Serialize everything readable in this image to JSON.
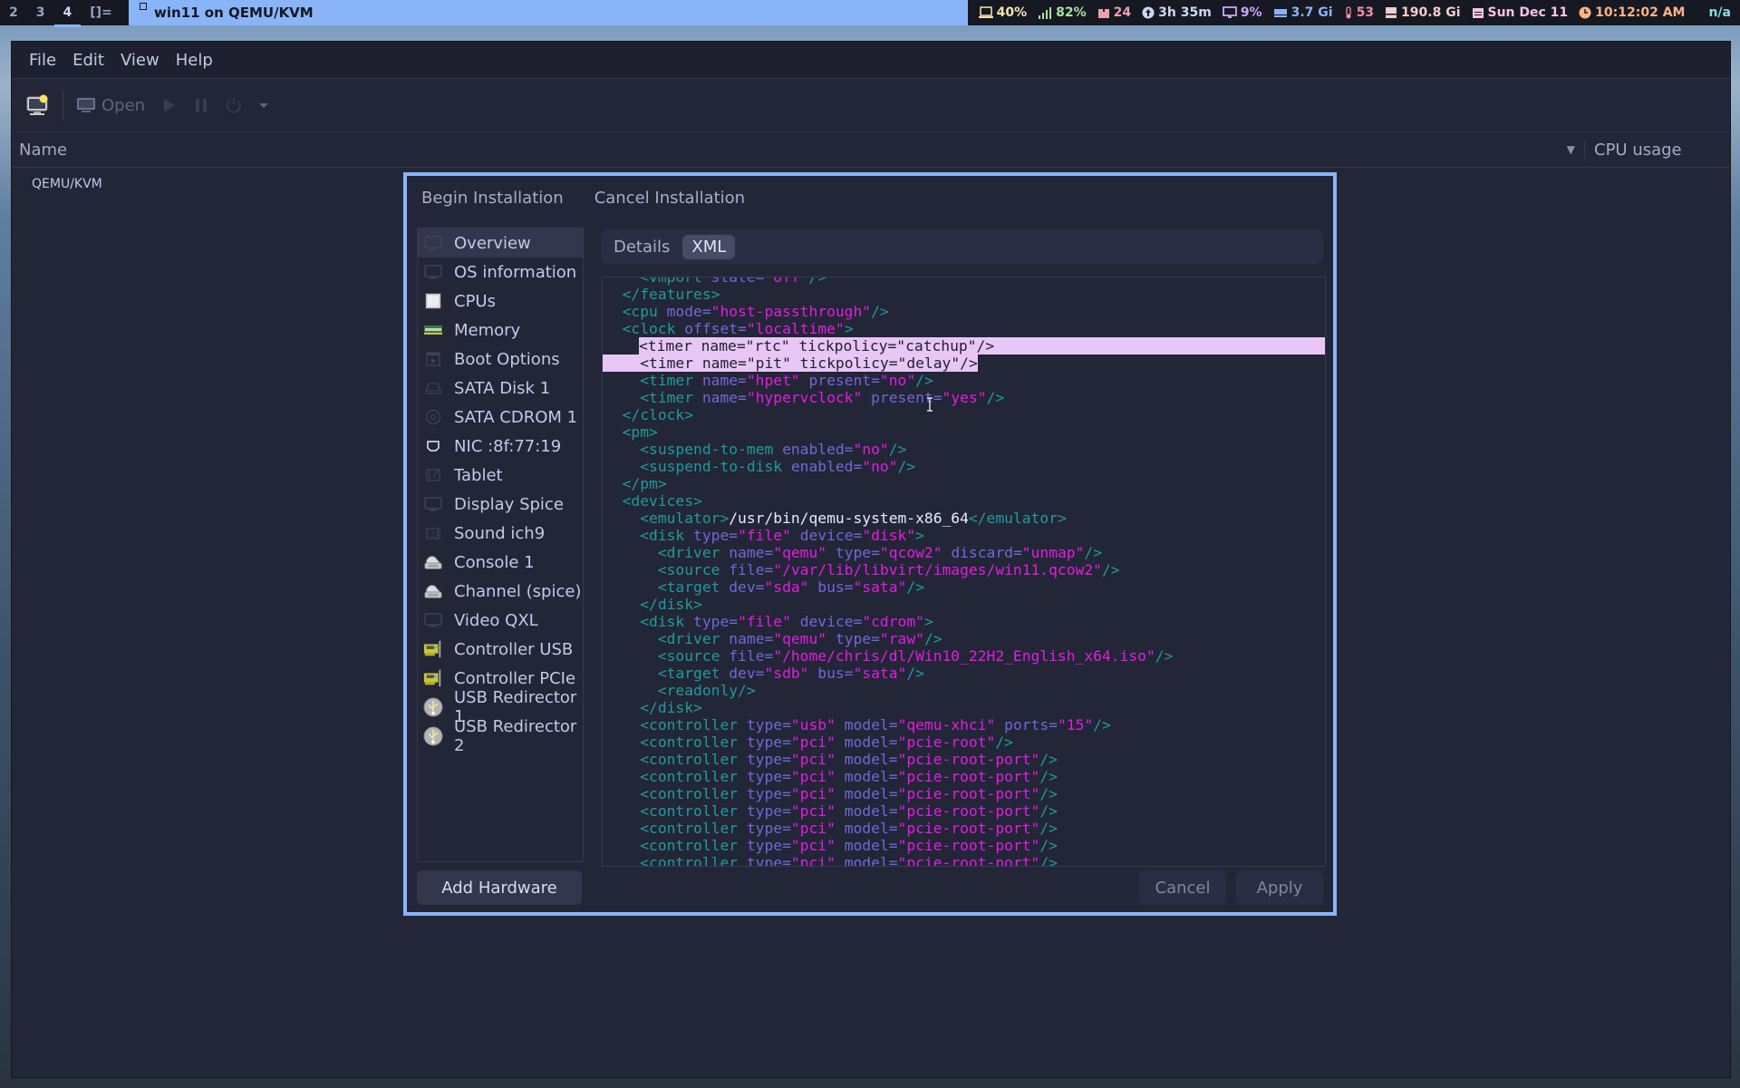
{
  "topbar": {
    "workspaces": [
      {
        "label": "2",
        "active": false
      },
      {
        "label": "3",
        "active": false
      },
      {
        "label": "4",
        "active": true
      },
      {
        "label": "[]=",
        "active": false
      }
    ],
    "window_title": "win11 on QEMU/KVM",
    "status": [
      {
        "icon": "laptop-icon",
        "text": "40%",
        "color": "#f9e2af"
      },
      {
        "icon": "signal-icon",
        "text": "82%",
        "color": "#a6e3a1"
      },
      {
        "icon": "package-icon",
        "text": "24",
        "color": "#eba0ac"
      },
      {
        "icon": "uptime-icon",
        "text": "3h 35m",
        "color": "#cdd6f4"
      },
      {
        "icon": "monitor-icon",
        "text": "9%",
        "color": "#cba6f7"
      },
      {
        "icon": "ram-icon",
        "text": "3.7 Gi",
        "color": "#89b4fa"
      },
      {
        "icon": "thermometer-icon",
        "text": "53",
        "color": "#f38ba8"
      },
      {
        "icon": "disk-icon",
        "text": "190.8 Gi",
        "color": "#f2cdcd"
      },
      {
        "icon": "calendar-icon",
        "text": "Sun Dec 11",
        "color": "#f5c2e7"
      },
      {
        "icon": "clock-icon",
        "text": "10:12:02 AM",
        "color": "#fab387"
      },
      {
        "icon": "none",
        "text": "n/a",
        "color": "#89dceb"
      }
    ]
  },
  "menubar": {
    "items": [
      "File",
      "Edit",
      "View",
      "Help"
    ]
  },
  "toolbar": {
    "open_label": "Open"
  },
  "list": {
    "col_name": "Name",
    "col_cpu": "CPU usage",
    "connection": "QEMU/KVM"
  },
  "dialog": {
    "begin_label": "Begin Installation",
    "cancel_install_label": "Cancel Installation",
    "sidebar": [
      {
        "label": "Overview",
        "icon": "monitor-icon",
        "selected": true
      },
      {
        "label": "OS information",
        "icon": "monitor-icon",
        "selected": false
      },
      {
        "label": "CPUs",
        "icon": "cpu-icon",
        "selected": false
      },
      {
        "label": "Memory",
        "icon": "memory-icon",
        "selected": false
      },
      {
        "label": "Boot Options",
        "icon": "boot-icon",
        "selected": false
      },
      {
        "label": "SATA Disk 1",
        "icon": "harddisk-icon",
        "selected": false
      },
      {
        "label": "SATA CDROM 1",
        "icon": "cdrom-icon",
        "selected": false
      },
      {
        "label": "NIC :8f:77:19",
        "icon": "network-icon",
        "selected": false
      },
      {
        "label": "Tablet",
        "icon": "tablet-icon",
        "selected": false
      },
      {
        "label": "Display Spice",
        "icon": "monitor-icon",
        "selected": false
      },
      {
        "label": "Sound ich9",
        "icon": "soundcard-icon",
        "selected": false
      },
      {
        "label": "Console 1",
        "icon": "serial-icon",
        "selected": false
      },
      {
        "label": "Channel (spice)",
        "icon": "serial-icon",
        "selected": false
      },
      {
        "label": "Video QXL",
        "icon": "monitor-icon",
        "selected": false
      },
      {
        "label": "Controller USB",
        "icon": "pci-card-icon",
        "selected": false
      },
      {
        "label": "Controller PCIe",
        "icon": "pci-card-icon",
        "selected": false
      },
      {
        "label": "USB Redirector 1",
        "icon": "usb-icon",
        "selected": false
      },
      {
        "label": "USB Redirector 2",
        "icon": "usb-icon",
        "selected": false
      }
    ],
    "tabs": [
      {
        "label": "Details",
        "active": false
      },
      {
        "label": "XML",
        "active": true
      }
    ],
    "xml_lines": [
      {
        "indent": 4,
        "hl": false,
        "parts": [
          [
            "t",
            "<vmport "
          ],
          [
            "a",
            "state="
          ],
          [
            "v",
            "\"off\""
          ],
          [
            "t",
            "/>"
          ]
        ]
      },
      {
        "indent": 2,
        "hl": false,
        "parts": [
          [
            "t",
            "</features>"
          ]
        ]
      },
      {
        "indent": 2,
        "hl": false,
        "parts": [
          [
            "t",
            "<cpu "
          ],
          [
            "a",
            "mode="
          ],
          [
            "v",
            "\"host-passthrough\""
          ],
          [
            "t",
            "/>"
          ]
        ]
      },
      {
        "indent": 2,
        "hl": false,
        "parts": [
          [
            "t",
            "<clock "
          ],
          [
            "a",
            "offset="
          ],
          [
            "v",
            "\"localtime\""
          ],
          [
            "t",
            ">"
          ]
        ]
      },
      {
        "indent": 4,
        "hl": true,
        "parts": [
          [
            "t",
            "<timer "
          ],
          [
            "a",
            "name="
          ],
          [
            "v",
            "\"rtc\""
          ],
          [
            "a",
            " tickpolicy="
          ],
          [
            "v",
            "\"catchup\""
          ],
          [
            "t",
            "/>"
          ]
        ]
      },
      {
        "indent": 4,
        "hl": true,
        "parts": [
          [
            "t",
            "<timer "
          ],
          [
            "a",
            "name="
          ],
          [
            "v",
            "\"pit\""
          ],
          [
            "a",
            " tickpolicy="
          ],
          [
            "v",
            "\"delay\""
          ],
          [
            "t",
            "/>"
          ]
        ]
      },
      {
        "indent": 4,
        "hl": false,
        "parts": [
          [
            "t",
            "<timer "
          ],
          [
            "a",
            "name="
          ],
          [
            "v",
            "\"hpet\""
          ],
          [
            "a",
            " present="
          ],
          [
            "v",
            "\"no\""
          ],
          [
            "t",
            "/>"
          ]
        ]
      },
      {
        "indent": 4,
        "hl": false,
        "parts": [
          [
            "t",
            "<timer "
          ],
          [
            "a",
            "name="
          ],
          [
            "v",
            "\"hypervclock\""
          ],
          [
            "a",
            " present="
          ],
          [
            "v",
            "\"yes\""
          ],
          [
            "t",
            "/>"
          ]
        ]
      },
      {
        "indent": 2,
        "hl": false,
        "parts": [
          [
            "t",
            "</clock>"
          ]
        ]
      },
      {
        "indent": 2,
        "hl": false,
        "parts": [
          [
            "t",
            "<pm>"
          ]
        ]
      },
      {
        "indent": 4,
        "hl": false,
        "parts": [
          [
            "t",
            "<suspend-to-mem "
          ],
          [
            "a",
            "enabled="
          ],
          [
            "v",
            "\"no\""
          ],
          [
            "t",
            "/>"
          ]
        ]
      },
      {
        "indent": 4,
        "hl": false,
        "parts": [
          [
            "t",
            "<suspend-to-disk "
          ],
          [
            "a",
            "enabled="
          ],
          [
            "v",
            "\"no\""
          ],
          [
            "t",
            "/>"
          ]
        ]
      },
      {
        "indent": 2,
        "hl": false,
        "parts": [
          [
            "t",
            "</pm>"
          ]
        ]
      },
      {
        "indent": 2,
        "hl": false,
        "parts": [
          [
            "t",
            "<devices>"
          ]
        ]
      },
      {
        "indent": 4,
        "hl": false,
        "parts": [
          [
            "t",
            "<emulator>"
          ],
          [
            "x",
            "/usr/bin/qemu-system-x86_64"
          ],
          [
            "t",
            "</emulator>"
          ]
        ]
      },
      {
        "indent": 4,
        "hl": false,
        "parts": [
          [
            "t",
            "<disk "
          ],
          [
            "a",
            "type="
          ],
          [
            "v",
            "\"file\""
          ],
          [
            "a",
            " device="
          ],
          [
            "v",
            "\"disk\""
          ],
          [
            "t",
            ">"
          ]
        ]
      },
      {
        "indent": 6,
        "hl": false,
        "parts": [
          [
            "t",
            "<driver "
          ],
          [
            "a",
            "name="
          ],
          [
            "v",
            "\"qemu\""
          ],
          [
            "a",
            " type="
          ],
          [
            "v",
            "\"qcow2\""
          ],
          [
            "a",
            " discard="
          ],
          [
            "v",
            "\"unmap\""
          ],
          [
            "t",
            "/>"
          ]
        ]
      },
      {
        "indent": 6,
        "hl": false,
        "parts": [
          [
            "t",
            "<source "
          ],
          [
            "a",
            "file="
          ],
          [
            "v",
            "\"/var/lib/libvirt/images/win11.qcow2\""
          ],
          [
            "t",
            "/>"
          ]
        ]
      },
      {
        "indent": 6,
        "hl": false,
        "parts": [
          [
            "t",
            "<target "
          ],
          [
            "a",
            "dev="
          ],
          [
            "v",
            "\"sda\""
          ],
          [
            "a",
            " bus="
          ],
          [
            "v",
            "\"sata\""
          ],
          [
            "t",
            "/>"
          ]
        ]
      },
      {
        "indent": 4,
        "hl": false,
        "parts": [
          [
            "t",
            "</disk>"
          ]
        ]
      },
      {
        "indent": 4,
        "hl": false,
        "parts": [
          [
            "t",
            "<disk "
          ],
          [
            "a",
            "type="
          ],
          [
            "v",
            "\"file\""
          ],
          [
            "a",
            " device="
          ],
          [
            "v",
            "\"cdrom\""
          ],
          [
            "t",
            ">"
          ]
        ]
      },
      {
        "indent": 6,
        "hl": false,
        "parts": [
          [
            "t",
            "<driver "
          ],
          [
            "a",
            "name="
          ],
          [
            "v",
            "\"qemu\""
          ],
          [
            "a",
            " type="
          ],
          [
            "v",
            "\"raw\""
          ],
          [
            "t",
            "/>"
          ]
        ]
      },
      {
        "indent": 6,
        "hl": false,
        "parts": [
          [
            "t",
            "<source "
          ],
          [
            "a",
            "file="
          ],
          [
            "v",
            "\"/home/chris/dl/Win10_22H2_English_x64.iso\""
          ],
          [
            "t",
            "/>"
          ]
        ]
      },
      {
        "indent": 6,
        "hl": false,
        "parts": [
          [
            "t",
            "<target "
          ],
          [
            "a",
            "dev="
          ],
          [
            "v",
            "\"sdb\""
          ],
          [
            "a",
            " bus="
          ],
          [
            "v",
            "\"sata\""
          ],
          [
            "t",
            "/>"
          ]
        ]
      },
      {
        "indent": 6,
        "hl": false,
        "parts": [
          [
            "t",
            "<readonly/>"
          ]
        ]
      },
      {
        "indent": 4,
        "hl": false,
        "parts": [
          [
            "t",
            "</disk>"
          ]
        ]
      },
      {
        "indent": 4,
        "hl": false,
        "parts": [
          [
            "t",
            "<controller "
          ],
          [
            "a",
            "type="
          ],
          [
            "v",
            "\"usb\""
          ],
          [
            "a",
            " model="
          ],
          [
            "v",
            "\"qemu-xhci\""
          ],
          [
            "a",
            " ports="
          ],
          [
            "v",
            "\"15\""
          ],
          [
            "t",
            "/>"
          ]
        ]
      },
      {
        "indent": 4,
        "hl": false,
        "parts": [
          [
            "t",
            "<controller "
          ],
          [
            "a",
            "type="
          ],
          [
            "v",
            "\"pci\""
          ],
          [
            "a",
            " model="
          ],
          [
            "v",
            "\"pcie-root\""
          ],
          [
            "t",
            "/>"
          ]
        ]
      },
      {
        "indent": 4,
        "hl": false,
        "parts": [
          [
            "t",
            "<controller "
          ],
          [
            "a",
            "type="
          ],
          [
            "v",
            "\"pci\""
          ],
          [
            "a",
            " model="
          ],
          [
            "v",
            "\"pcie-root-port\""
          ],
          [
            "t",
            "/>"
          ]
        ]
      },
      {
        "indent": 4,
        "hl": false,
        "parts": [
          [
            "t",
            "<controller "
          ],
          [
            "a",
            "type="
          ],
          [
            "v",
            "\"pci\""
          ],
          [
            "a",
            " model="
          ],
          [
            "v",
            "\"pcie-root-port\""
          ],
          [
            "t",
            "/>"
          ]
        ]
      },
      {
        "indent": 4,
        "hl": false,
        "parts": [
          [
            "t",
            "<controller "
          ],
          [
            "a",
            "type="
          ],
          [
            "v",
            "\"pci\""
          ],
          [
            "a",
            " model="
          ],
          [
            "v",
            "\"pcie-root-port\""
          ],
          [
            "t",
            "/>"
          ]
        ]
      },
      {
        "indent": 4,
        "hl": false,
        "parts": [
          [
            "t",
            "<controller "
          ],
          [
            "a",
            "type="
          ],
          [
            "v",
            "\"pci\""
          ],
          [
            "a",
            " model="
          ],
          [
            "v",
            "\"pcie-root-port\""
          ],
          [
            "t",
            "/>"
          ]
        ]
      },
      {
        "indent": 4,
        "hl": false,
        "parts": [
          [
            "t",
            "<controller "
          ],
          [
            "a",
            "type="
          ],
          [
            "v",
            "\"pci\""
          ],
          [
            "a",
            " model="
          ],
          [
            "v",
            "\"pcie-root-port\""
          ],
          [
            "t",
            "/>"
          ]
        ]
      },
      {
        "indent": 4,
        "hl": false,
        "parts": [
          [
            "t",
            "<controller "
          ],
          [
            "a",
            "type="
          ],
          [
            "v",
            "\"pci\""
          ],
          [
            "a",
            " model="
          ],
          [
            "v",
            "\"pcie-root-port\""
          ],
          [
            "t",
            "/>"
          ]
        ]
      },
      {
        "indent": 4,
        "hl": false,
        "parts": [
          [
            "t",
            "<controller "
          ],
          [
            "a",
            "type="
          ],
          [
            "v",
            "\"pci\""
          ],
          [
            "a",
            " model="
          ],
          [
            "v",
            "\"pcie-root-port\""
          ],
          [
            "t",
            "/>"
          ]
        ]
      }
    ],
    "add_hardware_label": "Add Hardware",
    "cancel_label": "Cancel",
    "apply_label": "Apply"
  }
}
